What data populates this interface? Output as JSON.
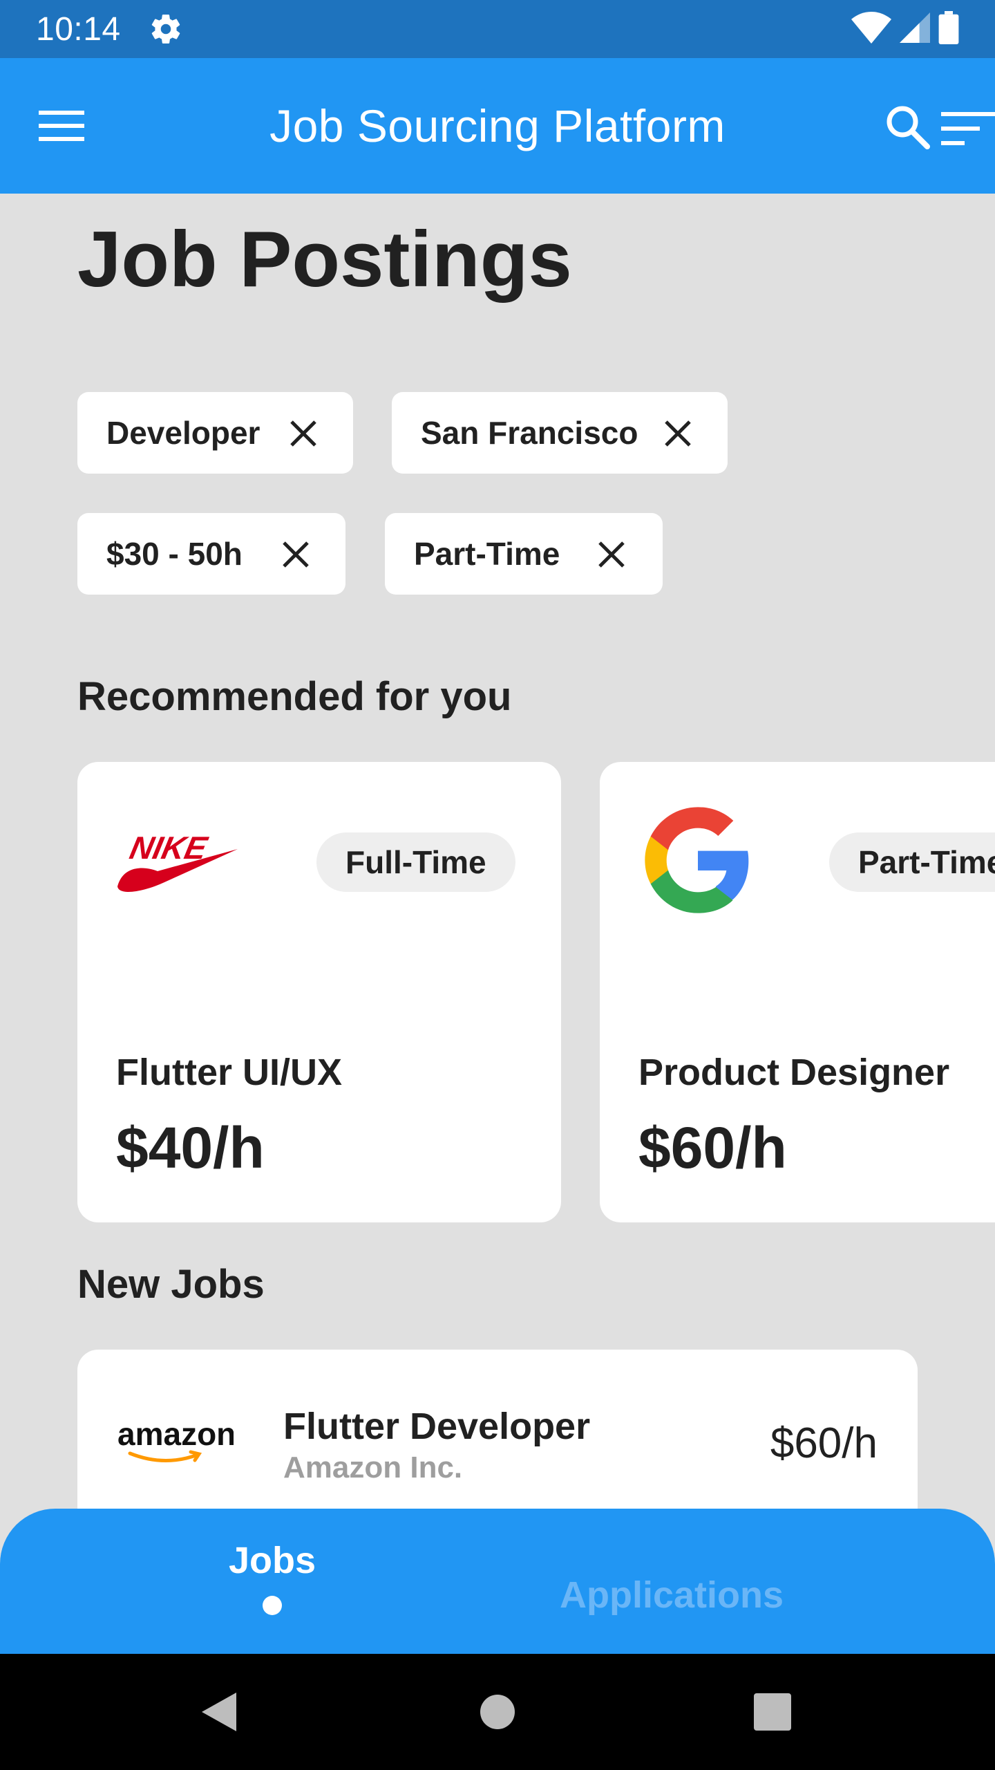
{
  "status_bar": {
    "time": "10:14",
    "icons": [
      "gear-icon",
      "wifi-icon",
      "signal-icon",
      "battery-icon"
    ],
    "color": "#1e73be"
  },
  "app_bar": {
    "title": "Job Sourcing Platform",
    "icons": [
      "menu-icon",
      "search-icon",
      "filter-icon"
    ],
    "color": "#2196f3"
  },
  "page": {
    "title": "Job Postings"
  },
  "filters": [
    {
      "label": "Developer"
    },
    {
      "label": "San Francisco"
    },
    {
      "label": "$30 - 50h"
    },
    {
      "label": "Part-Time"
    }
  ],
  "recommended": {
    "heading": "Recommended for you",
    "cards": [
      {
        "company_logo": "nike-logo",
        "logo_text": "NIKE",
        "type": "Full-Time",
        "title": "Flutter UI/UX",
        "rate": "$40/h"
      },
      {
        "company_logo": "google-logo",
        "type": "Part-Time",
        "title": "Product Designer",
        "rate": "$60/h"
      }
    ]
  },
  "new_jobs": {
    "heading": "New Jobs",
    "items": [
      {
        "company_logo": "amazon-logo",
        "logo_text": "amazon",
        "title": "Flutter Developer",
        "company": "Amazon Inc.",
        "rate": "$60/h"
      }
    ]
  },
  "bottom_nav": {
    "tabs": [
      {
        "label": "Jobs",
        "active": true
      },
      {
        "label": "Applications",
        "active": false
      }
    ]
  },
  "system_nav": {
    "icons": [
      "back-icon",
      "home-icon",
      "recents-icon"
    ]
  }
}
